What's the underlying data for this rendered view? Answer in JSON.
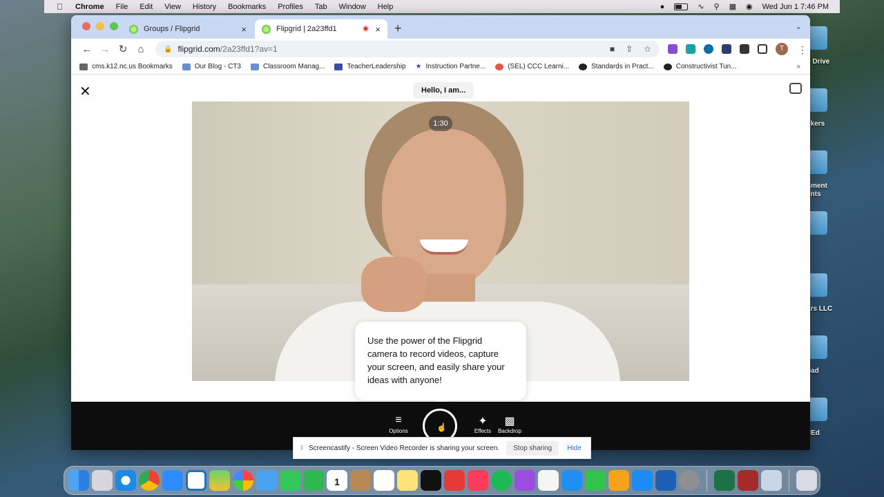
{
  "menubar": {
    "app": "Chrome",
    "items": [
      "File",
      "Edit",
      "View",
      "History",
      "Bookmarks",
      "Profiles",
      "Tab",
      "Window",
      "Help"
    ],
    "clock": "Wed Jun 1  7:46 PM"
  },
  "tabs": [
    {
      "title": "Groups / Flipgrid",
      "close": "×"
    },
    {
      "title": "Flipgrid | 2a23ffd1",
      "close": "×"
    }
  ],
  "newtab": "+",
  "omnibox": {
    "domain": "flipgrid.com",
    "path": "/2a23ffd1?av=1"
  },
  "bookmarks": [
    "cms.k12.nc.us Bookmarks",
    "Our Blog - CT3",
    "Classroom Manag...",
    "TeacherLeadership",
    "Instruction Partne...",
    "(SEL) CCC Learni...",
    "Standards in Pract...",
    "Constructivist Tun..."
  ],
  "bookmarks_more": "»",
  "avatar_initial": "T",
  "page": {
    "hello_label": "Hello, I am...",
    "timer": "1:30",
    "tooltip": "Use the power of the Flipgrid camera to record videos, capture your screen, and easily share your ideas with anyone!",
    "controls": {
      "options": "Options",
      "effects": "Effects",
      "backdrop": "Backdrop"
    }
  },
  "sharebar": {
    "message": "Screencastify - Screen Video Recorder is sharing your screen.",
    "stop": "Stop sharing",
    "hide": "Hide"
  },
  "desktop_labels": [
    "e Drive",
    "ckers",
    "nment",
    "ents",
    "ars LLC",
    "oad",
    "dEd"
  ],
  "dock": {
    "calendar_month": "JUN",
    "calendar_day": "1"
  }
}
